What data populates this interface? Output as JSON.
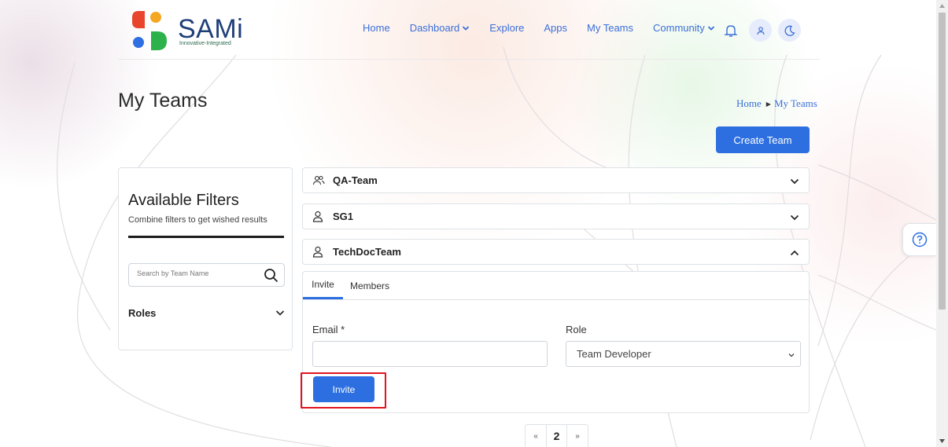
{
  "brand": {
    "name": "SAMi",
    "tagline": "Innovative-Integrated",
    "colors": {
      "red": "#e8452c",
      "orange": "#f5a623",
      "blue": "#2f6fe2",
      "green": "#2db14a"
    }
  },
  "nav": {
    "items": [
      {
        "label": "Home"
      },
      {
        "label": "Dashboard",
        "has_dropdown": true
      },
      {
        "label": "Explore"
      },
      {
        "label": "Apps"
      },
      {
        "label": "My Teams"
      },
      {
        "label": "Community",
        "has_dropdown": true
      }
    ],
    "icons": [
      "bell-icon",
      "user-icon",
      "moon-icon"
    ]
  },
  "page": {
    "title": "My Teams",
    "breadcrumb": [
      "Home",
      "My Teams"
    ],
    "create_button": "Create Team"
  },
  "filters": {
    "title": "Available Filters",
    "subtitle": "Combine filters to get wished results",
    "search_placeholder": "Search by Team Name",
    "roles_label": "Roles"
  },
  "teams": [
    {
      "name": "QA-Team",
      "icon": "users-icon",
      "expanded": false
    },
    {
      "name": "SG1",
      "icon": "user-icon",
      "expanded": false
    },
    {
      "name": "TechDocTeam",
      "icon": "user-icon",
      "expanded": true
    }
  ],
  "team_panel": {
    "tabs": [
      {
        "label": "Invite",
        "active": true
      },
      {
        "label": "Members",
        "active": false
      }
    ],
    "email_label": "Email *",
    "email_value": "",
    "role_label": "Role",
    "role_selected": "Team Developer",
    "invite_button": "Invite"
  },
  "pagination": {
    "prev": "«",
    "current": "2",
    "next": "»"
  },
  "accent_color": "#2d6fe0",
  "highlight_color": "#e0141e"
}
